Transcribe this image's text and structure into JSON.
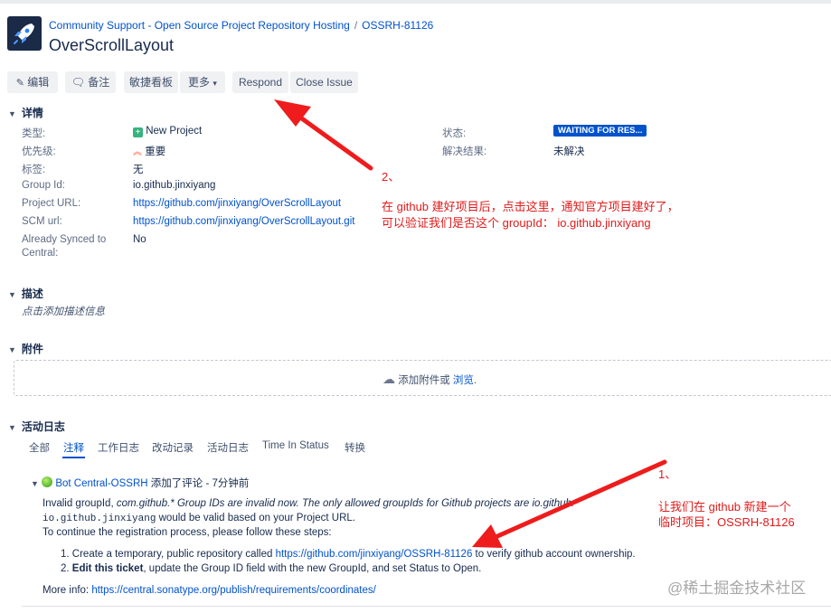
{
  "breadcrumb": {
    "project": "Community Support - Open Source Project Repository Hosting",
    "separator": "/",
    "issue_key": "OSSRH-81126"
  },
  "issue": {
    "title": "OverScrollLayout"
  },
  "toolbar": {
    "edit": "编辑",
    "comment": "备注",
    "agile_board": "敏捷看板",
    "more": "更多",
    "respond": "Respond",
    "close_issue": "Close Issue"
  },
  "details": {
    "heading": "详情",
    "type_label": "类型:",
    "type_value": "New Project",
    "priority_label": "优先级:",
    "priority_value": "重要",
    "labels_label": "标签:",
    "labels_value": "无",
    "group_id_label": "Group Id:",
    "group_id_value": "io.github.jinxiyang",
    "project_url_label": "Project URL:",
    "project_url_value": "https://github.com/jinxiyang/OverScrollLayout",
    "scm_url_label": "SCM url:",
    "scm_url_value": "https://github.com/jinxiyang/OverScrollLayout.git",
    "synced_label_1": "Already Synced to",
    "synced_label_2": "Central:",
    "synced_value": "No",
    "status_label": "状态:",
    "status_value": "WAITING FOR RES...",
    "resolution_label": "解决结果:",
    "resolution_value": "未解决"
  },
  "description": {
    "heading": "描述",
    "placeholder": "点击添加描述信息"
  },
  "attachments": {
    "heading": "附件",
    "drop_text": "添加附件或",
    "browse": "浏览",
    "period": "."
  },
  "activity": {
    "heading": "活动日志",
    "tabs": [
      "全部",
      "注释",
      "工作日志",
      "改动记录",
      "活动日志",
      "Time In Status",
      "转换"
    ],
    "active_tab": "注释"
  },
  "comment": {
    "author": "Bot Central-OSSRH",
    "action": " 添加了评论 - 7分钟前",
    "line1_a": "Invalid groupId, ",
    "line1_b": "com.github.* Group IDs are invalid now. The only allowed groupIds for Github projects are io.github.*",
    "line2_mono": "io.github.jinxiyang",
    "line2_rest": " would be valid based on your Project URL.",
    "line3": "To continue the registration process, please follow these steps:",
    "step1_a": "Create a temporary, public repository called ",
    "step1_link": "https://github.com/jinxiyang/OSSRH-81126",
    "step1_b": " to verify github account ownership.",
    "step2_bold": "Edit this ticket",
    "step2_rest": ", update the Group ID field with the new GroupId, and set Status to Open.",
    "more_info_label": "More info: ",
    "more_info_link": "https://central.sonatype.org/publish/requirements/coordinates/"
  },
  "annotations": {
    "a2_num": "2、",
    "a2_line1": "在 github 建好项目后，点击这里，通知官方项目建好了，",
    "a2_line2": "可以验证我们是否这个 groupId：  io.github.jinxiyang",
    "a1_num": "1、",
    "a1_line1": "让我们在 github 新建一个",
    "a1_line2": "临时项目：OSSRH-81126"
  },
  "watermark": "@稀土掘金技术社区",
  "colors": {
    "accent": "#0052cc",
    "annotation": "#e01b1b",
    "status_badge": "#0052cc"
  }
}
